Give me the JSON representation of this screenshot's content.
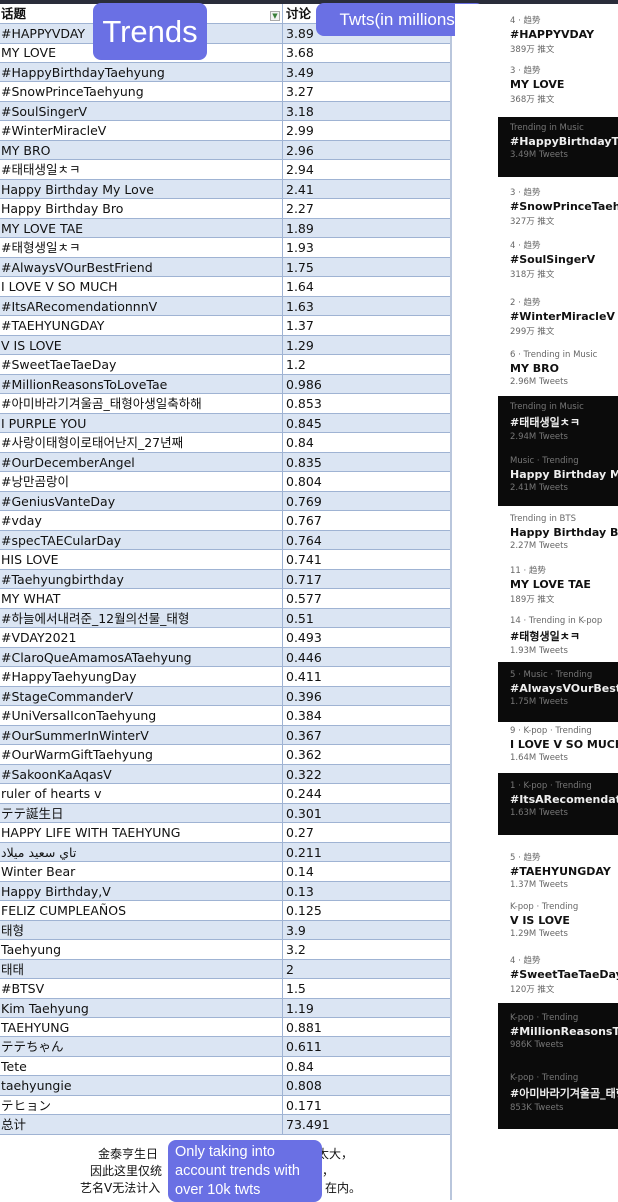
{
  "overlays": {
    "trends": "Trends",
    "twts": "Twts(in millions)",
    "note": "Only taking into account trends with over 10k twts"
  },
  "table": {
    "headers": [
      "话题",
      "讨论"
    ],
    "rows": [
      [
        "#HAPPYVDAY",
        "3.89"
      ],
      [
        "MY LOVE",
        "3.68"
      ],
      [
        "#HappyBirthdayTaehyung",
        "3.49"
      ],
      [
        "#SnowPrinceTaehyung",
        "3.27"
      ],
      [
        "#SoulSingerV",
        "3.18"
      ],
      [
        "#WinterMiracleV",
        "2.99"
      ],
      [
        "MY BRO",
        "2.96"
      ],
      [
        "#태태생일ㅊㅋ",
        "2.94"
      ],
      [
        "Happy Birthday My Love",
        "2.41"
      ],
      [
        "Happy Birthday Bro",
        "2.27"
      ],
      [
        "MY LOVE TAE",
        "1.89"
      ],
      [
        "#태형생일ㅊㅋ",
        "1.93"
      ],
      [
        "#AlwaysVOurBestFriend",
        "1.75"
      ],
      [
        "I LOVE V SO MUCH",
        "1.64"
      ],
      [
        "#ItsARecomendationnnV",
        "1.63"
      ],
      [
        "#TAEHYUNGDAY",
        "1.37"
      ],
      [
        "V IS LOVE",
        "1.29"
      ],
      [
        "#SweetTaeTaeDay",
        "1.2"
      ],
      [
        "#MillionReasonsToLoveTae",
        "0.986"
      ],
      [
        "#아미바라기겨울곰_태형아생일축하해",
        "0.853"
      ],
      [
        "I PURPLE YOU",
        "0.845"
      ],
      [
        "#사랑이태형이로태어난지_27년째",
        "0.84"
      ],
      [
        "#OurDecemberAngel",
        "0.835"
      ],
      [
        "#낭만곰랑이",
        "0.804"
      ],
      [
        "#GeniusVanteDay",
        "0.769"
      ],
      [
        "#vday",
        "0.767"
      ],
      [
        "#specTAECularDay",
        "0.764"
      ],
      [
        "HIS LOVE",
        "0.741"
      ],
      [
        "#Taehyungbirthday",
        "0.717"
      ],
      [
        "MY WHAT",
        "0.577"
      ],
      [
        "#하늘에서내려준_12월의선물_태형",
        "0.51"
      ],
      [
        "#VDAY2021",
        "0.493"
      ],
      [
        "#ClaroQueAmamosATaehyung",
        "0.446"
      ],
      [
        "#HappyTaehyungDay",
        "0.411"
      ],
      [
        "#StageCommanderV",
        "0.396"
      ],
      [
        "#UniVersalIconTaehyung",
        "0.384"
      ],
      [
        "#OurSummerInWinterV",
        "0.367"
      ],
      [
        "#OurWarmGiftTaehyung",
        "0.362"
      ],
      [
        "#SakoonKaAqasV",
        "0.322"
      ],
      [
        "ruler of hearts v",
        "0.244"
      ],
      [
        "テテ誕生日",
        "0.301"
      ],
      [
        "HAPPY LIFE WITH TAEHYUNG",
        "0.27"
      ],
      [
        "تاي سعيد ميلاد",
        "0.211"
      ],
      [
        "Winter Bear",
        "0.14"
      ],
      [
        "Happy Birthday,V",
        "0.13"
      ],
      [
        "FELIZ CUMPLEAÑOS",
        "0.125"
      ],
      [
        "태형",
        "3.9"
      ],
      [
        "Taehyung",
        "3.2"
      ],
      [
        "태태",
        "2"
      ],
      [
        "#BTSV",
        "1.5"
      ],
      [
        "Kim Taehyung",
        "1.19"
      ],
      [
        "TAEHYUNG",
        "0.881"
      ],
      [
        "テテちゃん",
        "0.611"
      ],
      [
        "Tete",
        "0.84"
      ],
      [
        "taehyungie",
        "0.808"
      ],
      [
        "テヒョン",
        "0.171"
      ],
      [
        "总计",
        "73.491"
      ]
    ]
  },
  "note_fragments": [
    "金泰亨生日",
    "据太大，",
    "因此这里仅统",
    "题，",
    "艺名V无法计入",
    "在内。"
  ],
  "feed": [
    {
      "meta": "4 · 趋势",
      "title": "#HAPPYVDAY",
      "count": "389万 推文"
    },
    {
      "meta": "3 · 趋势",
      "title": "MY LOVE",
      "count": "368万 推文"
    },
    {
      "meta": "Trending in Music",
      "title": "#HappyBirthdayTaehyung",
      "count": "3.49M Tweets"
    },
    {
      "meta": "3 · 趋势",
      "title": "#SnowPrinceTaehyung",
      "count": "327万 推文"
    },
    {
      "meta": "4 · 趋势",
      "title": "#SoulSingerV",
      "count": "318万 推文"
    },
    {
      "meta": "2 · 趋势",
      "title": "#WinterMiracleV",
      "count": "299万 推文"
    },
    {
      "meta": "6 · Trending in Music",
      "title": "MY BRO",
      "count": "2.96M Tweets"
    },
    {
      "meta": "Trending in Music",
      "title": "#태태생일ㅊㅋ",
      "count": "2.94M Tweets"
    },
    {
      "meta": "Music · Trending",
      "title": "Happy Birthday My Love",
      "count": "2.41M Tweets"
    },
    {
      "meta": "Trending in BTS",
      "title": "Happy Birthday Bro",
      "count": "2.27M Tweets"
    },
    {
      "meta": "11 · 趋势",
      "title": "MY LOVE TAE",
      "count": "189万 推文"
    },
    {
      "meta": "14 · Trending in K-pop",
      "title": "#태형생일ㅊㅋ",
      "count": "1.93M Tweets"
    },
    {
      "meta": "5 · Music · Trending",
      "title": "#AlwaysVOurBestFriend",
      "count": "1.75M Tweets"
    },
    {
      "meta": "9 · K-pop · Trending",
      "title": "I LOVE V SO MUCH",
      "count": "1.64M Tweets"
    },
    {
      "meta": "1 · K-pop · Trending",
      "title": "#ItsARecomendationnnV",
      "count": "1.63M Tweets"
    },
    {
      "meta": "5 · 趋势",
      "title": "#TAEHYUNGDAY",
      "count": "1.37M Tweets"
    },
    {
      "meta": "K-pop · Trending",
      "title": "V IS LOVE",
      "count": "1.29M Tweets"
    },
    {
      "meta": "4 · 趋势",
      "title": "#SweetTaeTaeDay",
      "count": "120万 推文"
    },
    {
      "meta": "K-pop · Trending",
      "title": "#MillionReasonsToLoveTae",
      "count": "986K Tweets"
    },
    {
      "meta": "K-pop · Trending",
      "title": "#아미바라기겨울곰_태형",
      "count": "853K Tweets"
    }
  ]
}
